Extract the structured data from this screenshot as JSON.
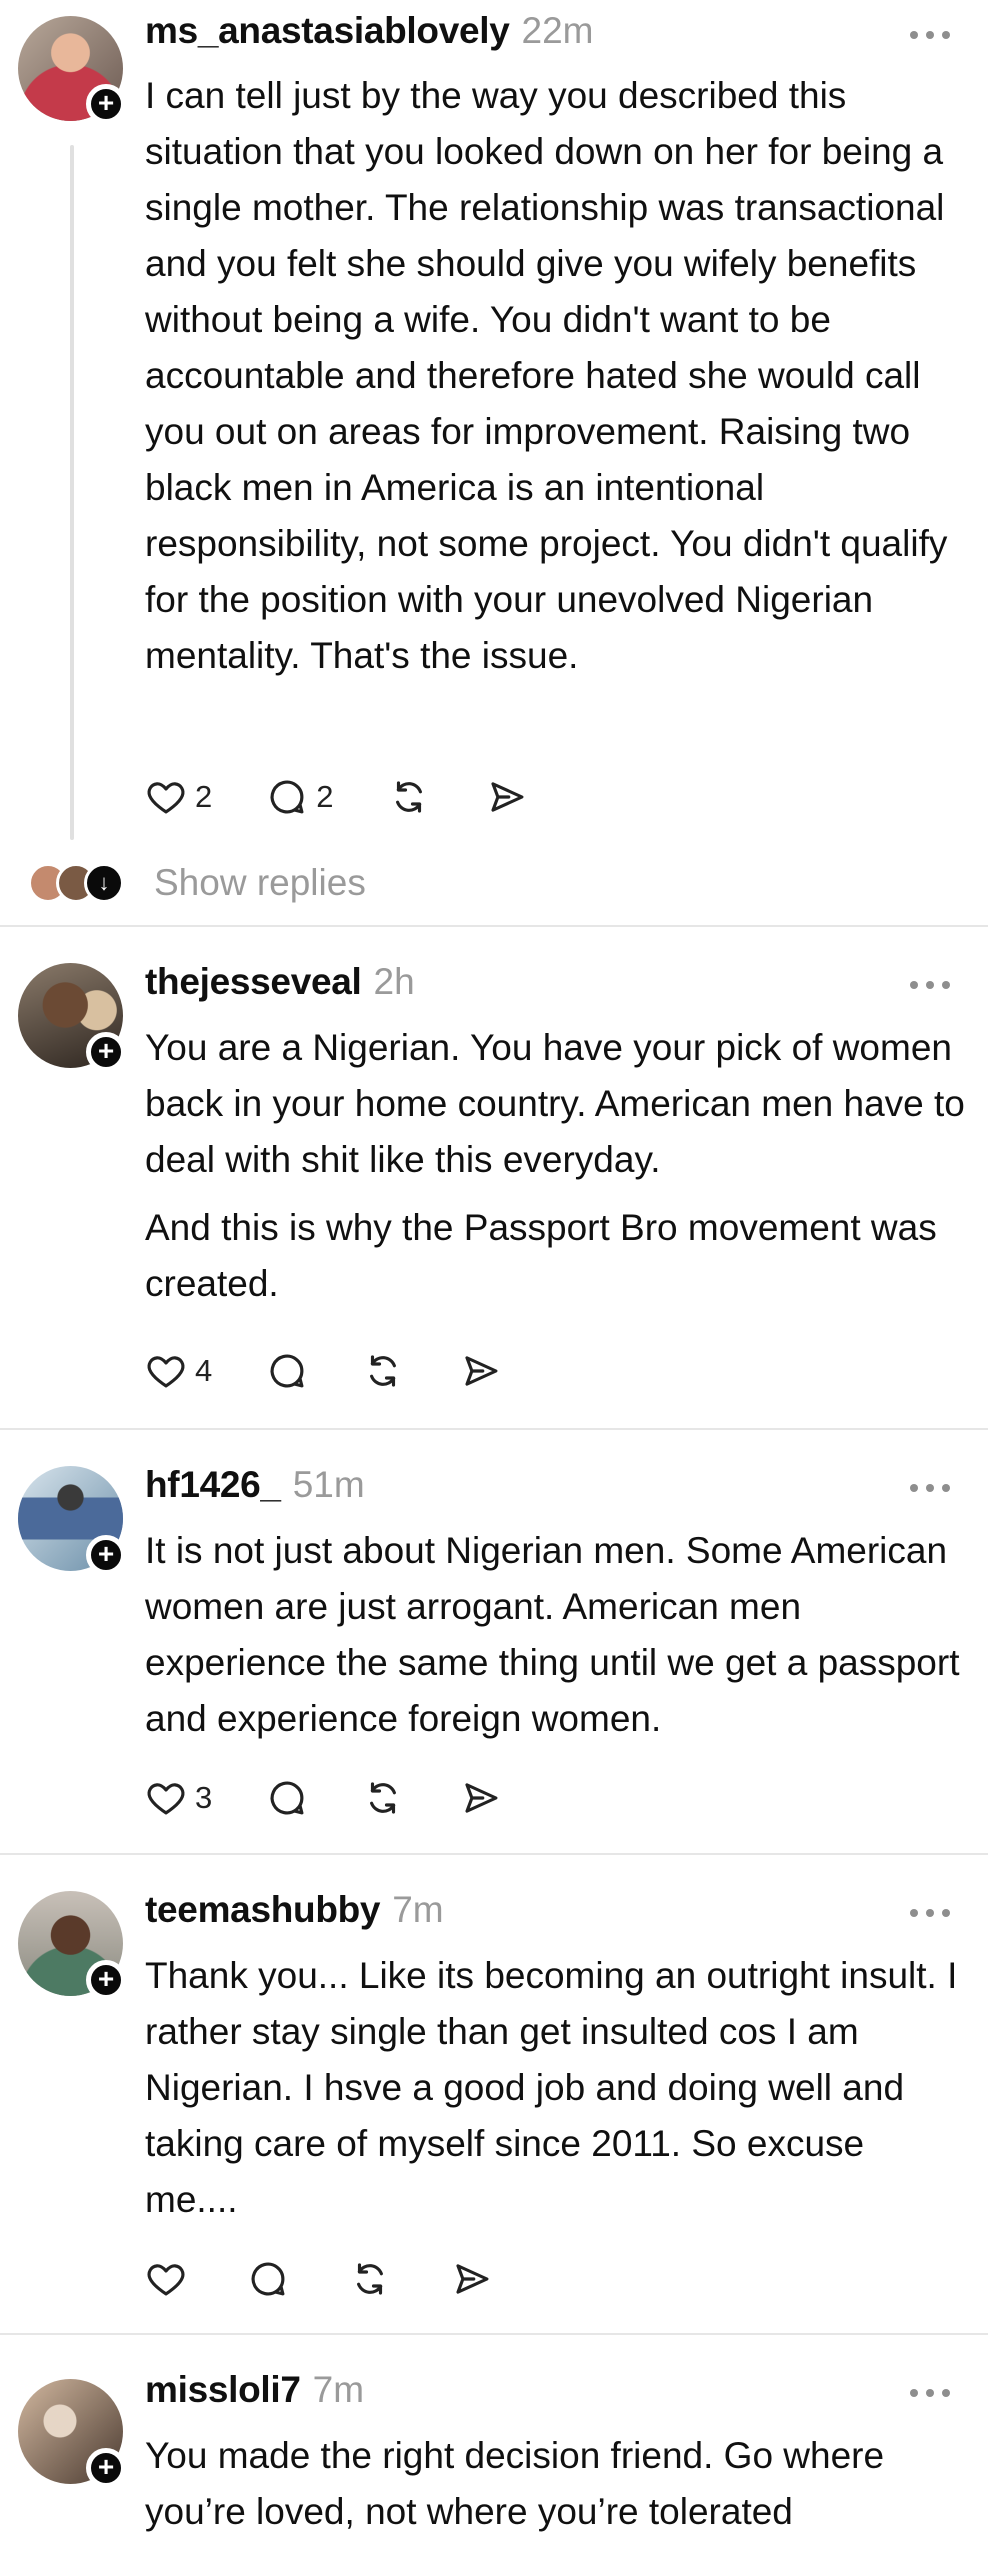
{
  "posts": [
    {
      "username": "ms_anastasiablovely",
      "time": "22m",
      "paragraphs": [
        "I can tell just by the way you described this situation that you looked down on her for being a single mother. The relationship was transactional and you felt she should give you wifely benefits without being a wife. You didn't want to be accountable and therefore hated she would call you out on areas for improvement. Raising two black men in America is an intentional responsibility, not some project. You didn't qualify for the position with your unevolved Nigerian mentality. That's the issue."
      ],
      "likes": "2",
      "replies": "2",
      "show_replies": "Show replies",
      "avatar_color": "#c43a4a"
    },
    {
      "username": "thejesseveal",
      "time": "2h",
      "paragraphs": [
        "You are a Nigerian.  You have your pick of women back in your home country.  American men have to deal with shit like this everyday.",
        "And this is why the Passport Bro movement was created."
      ],
      "likes": "4",
      "replies": "",
      "avatar_color": "#6b4a34"
    },
    {
      "username": "hf1426_",
      "time": "51m",
      "paragraphs": [
        "It is not just about Nigerian men. Some American women are just arrogant. American men experience the same thing until we get a passport and experience foreign women."
      ],
      "likes": "3",
      "replies": "",
      "avatar_color": "#5e7fa6"
    },
    {
      "username": "teemashubby",
      "time": "7m",
      "paragraphs": [
        "Thank you... Like its becoming an outright insult.  I rather stay single than get insulted cos I am Nigerian.  I hsve a good job and doing well and  taking care of myself since 2011. So excuse me...."
      ],
      "likes": "",
      "replies": "",
      "avatar_color": "#4d7a63"
    },
    {
      "username": "missloli7",
      "time": "7m",
      "paragraphs": [
        "You made the right decision friend. Go where you’re loved, not where you’re tolerated"
      ],
      "likes": "",
      "replies": "",
      "avatar_color": "#8a6a52"
    }
  ],
  "icons": {
    "like": "heart-icon",
    "reply": "comment-icon",
    "repost": "repost-icon",
    "share": "send-icon",
    "more": "more-icon",
    "follow": "plus-icon"
  }
}
